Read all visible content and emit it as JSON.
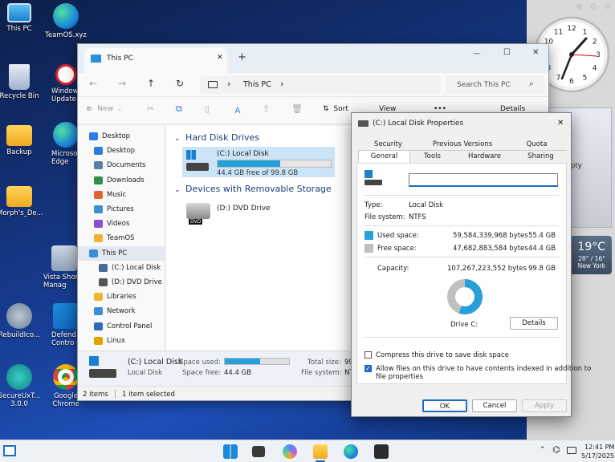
{
  "desktop": {
    "icons": [
      {
        "label": "This PC"
      },
      {
        "label": "TeamOS.xyz"
      },
      {
        "label": "Recycle Bin"
      },
      {
        "label": "Window Update"
      },
      {
        "label": "Backup"
      },
      {
        "label": "Microso Edge"
      },
      {
        "label": "Morph's_De..."
      },
      {
        "label": "Vista Shor Manag"
      },
      {
        "label": "RebuildIco..."
      },
      {
        "label": "Defend Contro"
      },
      {
        "label": "SecureUxT... 3.0.0"
      },
      {
        "label": "Google Chrome"
      }
    ]
  },
  "gadgets": {
    "clock": {
      "numbers": [
        "12",
        "1",
        "2",
        "3",
        "4",
        "5",
        "6",
        "7",
        "8",
        "9",
        "10",
        "11"
      ]
    },
    "slideshow_text": "pty",
    "weather": {
      "temp": "19°C",
      "range": "28° / 16°",
      "city": "New York"
    }
  },
  "explorer": {
    "tab_title": "This PC",
    "add_tab": "+",
    "close_tab": "✕",
    "window_controls": {
      "minimize": "—",
      "maximize": "☐",
      "close": "✕"
    },
    "breadcrumb": [
      "This PC"
    ],
    "search_placeholder": "Search This PC",
    "toolbar": {
      "new": "New",
      "sort": "Sort",
      "view": "View",
      "more": "•••",
      "details": "Details"
    },
    "nav": [
      {
        "label": "Desktop",
        "color": "#2b7de1"
      },
      {
        "label": "Desktop",
        "color": "#2b7de1"
      },
      {
        "label": "Documents",
        "color": "#5c7fa8"
      },
      {
        "label": "Downloads",
        "color": "#2f8f4e"
      },
      {
        "label": "Music",
        "color": "#e0622f"
      },
      {
        "label": "Pictures",
        "color": "#3a8fd6"
      },
      {
        "label": "Videos",
        "color": "#8a4fd1"
      },
      {
        "label": "TeamOS",
        "color": "#f2b533"
      },
      {
        "label": "This PC",
        "color": "#3a8fd6"
      },
      {
        "label": "(C:) Local Disk",
        "color": "#4a6b9a"
      },
      {
        "label": "(D:) DVD Drive",
        "color": "#555555"
      },
      {
        "label": "Libraries",
        "color": "#f2b533"
      },
      {
        "label": "Network",
        "color": "#3a8fd6"
      },
      {
        "label": "Control Panel",
        "color": "#2c6bb8"
      },
      {
        "label": "Linux",
        "color": "#e6a100"
      }
    ],
    "groups": [
      {
        "title": "Hard Disk Drives"
      },
      {
        "title": "Devices with Removable Storage"
      }
    ],
    "drive_c": {
      "name": "(C:) Local Disk",
      "free": "44.4 GB free of 99.8 GB",
      "used_fraction": 0.555
    },
    "drive_d": {
      "name": "(D:) DVD Drive",
      "badge": "DVD"
    },
    "details": {
      "name": "(C:) Local Disk",
      "type": "Local Disk",
      "space_used_label": "Space used:",
      "space_free_label": "Space free:",
      "space_free": "44.4 GB",
      "total_size_label": "Total size:",
      "total_size": "99",
      "file_system_label": "File system:",
      "file_system": "NT",
      "used_fraction": 0.555
    },
    "status": {
      "items": "2 items",
      "selected": "1 item selected"
    }
  },
  "properties": {
    "title": "(C:) Local Disk Properties",
    "close": "✕",
    "tabs_row1": [
      "Security",
      "Previous Versions",
      "Quota"
    ],
    "tabs_row2": [
      "General",
      "Tools",
      "Hardware",
      "Sharing"
    ],
    "name_value": "",
    "type_label": "Type:",
    "type_value": "Local Disk",
    "fs_label": "File system:",
    "fs_value": "NTFS",
    "used_label": "Used space:",
    "used_bytes": "59,584,339,968 bytes",
    "used_gb": "55.4 GB",
    "free_label": "Free space:",
    "free_bytes": "47,682,883,584 bytes",
    "free_gb": "44.4 GB",
    "capacity_label": "Capacity:",
    "capacity_bytes": "107,267,223,552 bytes",
    "capacity_gb": "99.8 GB",
    "drive_label": "Drive C:",
    "details_button": "Details",
    "compress_label": "Compress this drive to save disk space",
    "compress_checked": false,
    "index_label_1": "Allow files on this drive to have contents indexed in addition to",
    "index_label_2": "file properties",
    "index_checked": true,
    "ok": "OK",
    "cancel": "Cancel",
    "apply": "Apply",
    "used_fraction": 0.555,
    "colors": {
      "used": "#26a0da",
      "free": "#c0c0c0"
    }
  },
  "taskbar": {
    "time": "12:41 PM",
    "date": "5/17/2025"
  }
}
